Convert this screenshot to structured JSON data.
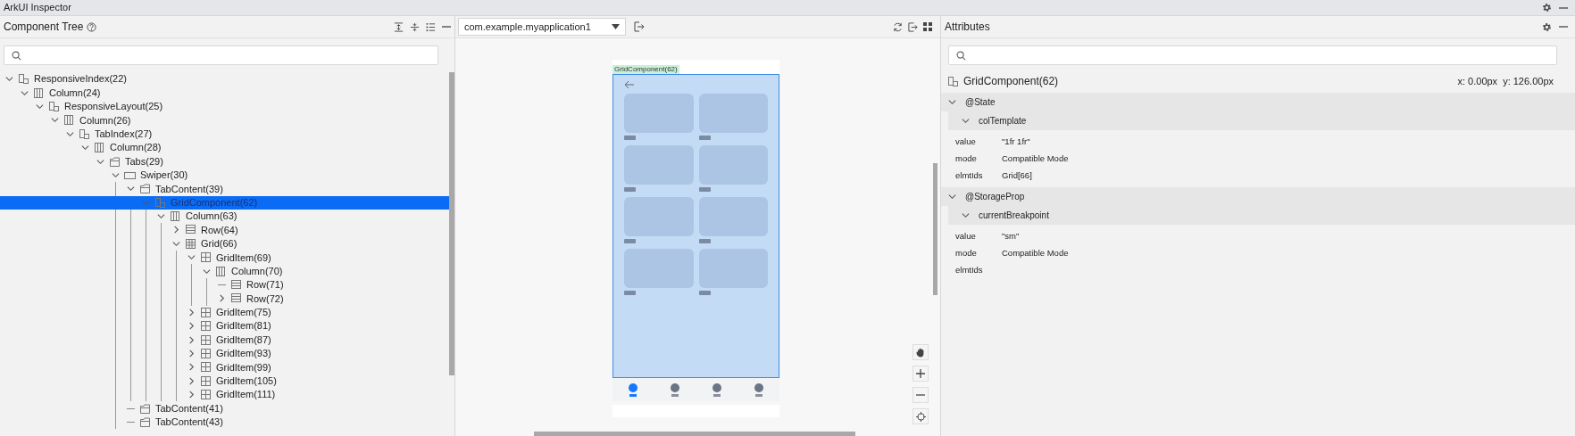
{
  "window": {
    "title": "ArkUI Inspector"
  },
  "component_tree": {
    "title": "Component Tree",
    "nodes": [
      {
        "label": "ResponsiveIndex(22)",
        "kind": "component",
        "selected": false,
        "expanded": true,
        "children": [
          {
            "label": "Column(24)",
            "kind": "column",
            "selected": false,
            "expanded": true,
            "children": [
              {
                "label": "ResponsiveLayout(25)",
                "kind": "component",
                "selected": false,
                "expanded": true,
                "children": [
                  {
                    "label": "Column(26)",
                    "kind": "column",
                    "selected": false,
                    "expanded": true,
                    "children": [
                      {
                        "label": "TabIndex(27)",
                        "kind": "component",
                        "selected": false,
                        "expanded": true,
                        "children": [
                          {
                            "label": "Column(28)",
                            "kind": "column",
                            "selected": false,
                            "expanded": true,
                            "children": [
                              {
                                "label": "Tabs(29)",
                                "kind": "tabs",
                                "selected": false,
                                "expanded": true,
                                "children": [
                                  {
                                    "label": "Swiper(30)",
                                    "kind": "swiper",
                                    "selected": false,
                                    "expanded": true,
                                    "children": [
                                      {
                                        "label": "TabContent(39)",
                                        "kind": "tabs",
                                        "selected": false,
                                        "expanded": true,
                                        "children": [
                                          {
                                            "label": "GridComponent(62)",
                                            "kind": "component",
                                            "selected": true,
                                            "expanded": true,
                                            "children": [
                                              {
                                                "label": "Column(63)",
                                                "kind": "column",
                                                "selected": false,
                                                "expanded": true,
                                                "children": [
                                                  {
                                                    "label": "Row(64)",
                                                    "kind": "row",
                                                    "selected": false,
                                                    "expanded": false
                                                  },
                                                  {
                                                    "label": "Grid(66)",
                                                    "kind": "grid",
                                                    "selected": false,
                                                    "expanded": true,
                                                    "children": [
                                                      {
                                                        "label": "GridItem(69)",
                                                        "kind": "griditem",
                                                        "selected": false,
                                                        "expanded": true,
                                                        "children": [
                                                          {
                                                            "label": "Column(70)",
                                                            "kind": "column",
                                                            "selected": false,
                                                            "expanded": true,
                                                            "children": [
                                                              {
                                                                "label": "Row(71)",
                                                                "kind": "row",
                                                                "selected": false
                                                              },
                                                              {
                                                                "label": "Row(72)",
                                                                "kind": "row",
                                                                "selected": false,
                                                                "expanded": false
                                                              }
                                                            ]
                                                          }
                                                        ]
                                                      },
                                                      {
                                                        "label": "GridItem(75)",
                                                        "kind": "griditem",
                                                        "selected": false,
                                                        "expanded": false
                                                      },
                                                      {
                                                        "label": "GridItem(81)",
                                                        "kind": "griditem",
                                                        "selected": false,
                                                        "expanded": false
                                                      },
                                                      {
                                                        "label": "GridItem(87)",
                                                        "kind": "griditem",
                                                        "selected": false,
                                                        "expanded": false
                                                      },
                                                      {
                                                        "label": "GridItem(93)",
                                                        "kind": "griditem",
                                                        "selected": false,
                                                        "expanded": false
                                                      },
                                                      {
                                                        "label": "GridItem(99)",
                                                        "kind": "griditem",
                                                        "selected": false,
                                                        "expanded": false
                                                      },
                                                      {
                                                        "label": "GridItem(105)",
                                                        "kind": "griditem",
                                                        "selected": false,
                                                        "expanded": false
                                                      },
                                                      {
                                                        "label": "GridItem(111)",
                                                        "kind": "griditem",
                                                        "selected": false,
                                                        "expanded": false
                                                      }
                                                    ]
                                                  }
                                                ]
                                              }
                                            ]
                                          }
                                        ]
                                      },
                                      {
                                        "label": "TabContent(41)",
                                        "kind": "tabs",
                                        "selected": false
                                      },
                                      {
                                        "label": "TabContent(43)",
                                        "kind": "tabs",
                                        "selected": false
                                      }
                                    ]
                                  }
                                ]
                              }
                            ]
                          }
                        ]
                      }
                    ]
                  }
                ]
              }
            ]
          }
        ]
      }
    ]
  },
  "preview": {
    "app": "com.example.myapplication1",
    "highlight_label": "GridComponent(62)",
    "tab_bar": [
      {
        "selected": true
      },
      {
        "selected": false
      },
      {
        "selected": false
      },
      {
        "selected": false
      }
    ]
  },
  "attributes": {
    "title": "Attributes",
    "component": "GridComponent(62)",
    "x": "x: 0.00px",
    "y": "y: 126.00px",
    "sections": [
      {
        "title": "@State",
        "expanded": true,
        "vars": [
          {
            "name": "colTemplate",
            "expanded": true,
            "props": [
              {
                "key": "value",
                "value": "\"1fr 1fr\""
              },
              {
                "key": "mode",
                "value": "Compatible Mode"
              },
              {
                "key": "elmtIds",
                "value": "Grid[66]"
              }
            ]
          }
        ]
      },
      {
        "title": "@StorageProp",
        "expanded": true,
        "vars": [
          {
            "name": "currentBreakpoint",
            "expanded": true,
            "props": [
              {
                "key": "value",
                "value": "\"sm\""
              },
              {
                "key": "mode",
                "value": "Compatible Mode"
              },
              {
                "key": "elmtIds"
              }
            ]
          }
        ]
      }
    ]
  }
}
